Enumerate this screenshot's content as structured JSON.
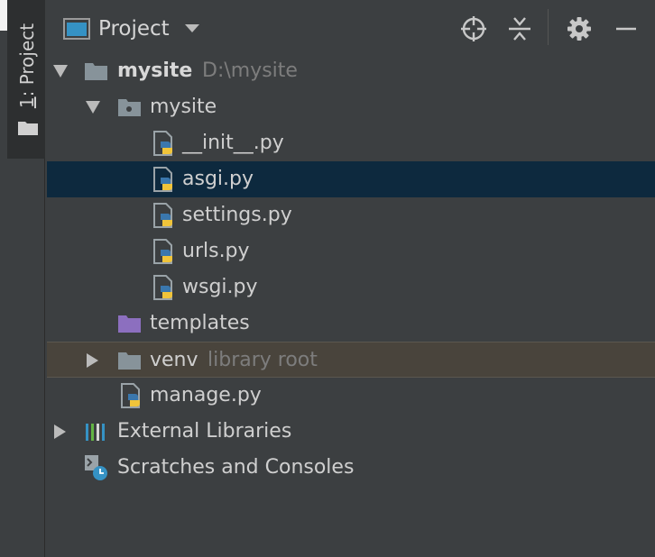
{
  "side_tab": {
    "number": "1",
    "label": ": Project"
  },
  "header": {
    "title": "Project"
  },
  "tree": {
    "root": {
      "name": "mysite",
      "path": "D:\\mysite"
    },
    "package": {
      "name": "mysite"
    },
    "files": [
      "__init__.py",
      "asgi.py",
      "settings.py",
      "urls.py",
      "wsgi.py"
    ],
    "templates": "templates",
    "venv": {
      "name": "venv",
      "note": "library root"
    },
    "manage": "manage.py",
    "external": "External Libraries",
    "scratches": "Scratches and Consoles"
  },
  "colors": {
    "background": "#3c3f41",
    "selected_row": "#0d293e",
    "excluded_row": "#49443c",
    "folder": "#87939a",
    "templates_folder": "#8c6fbf",
    "python_blue": "#3a77ad",
    "python_yellow": "#f0c43a"
  }
}
